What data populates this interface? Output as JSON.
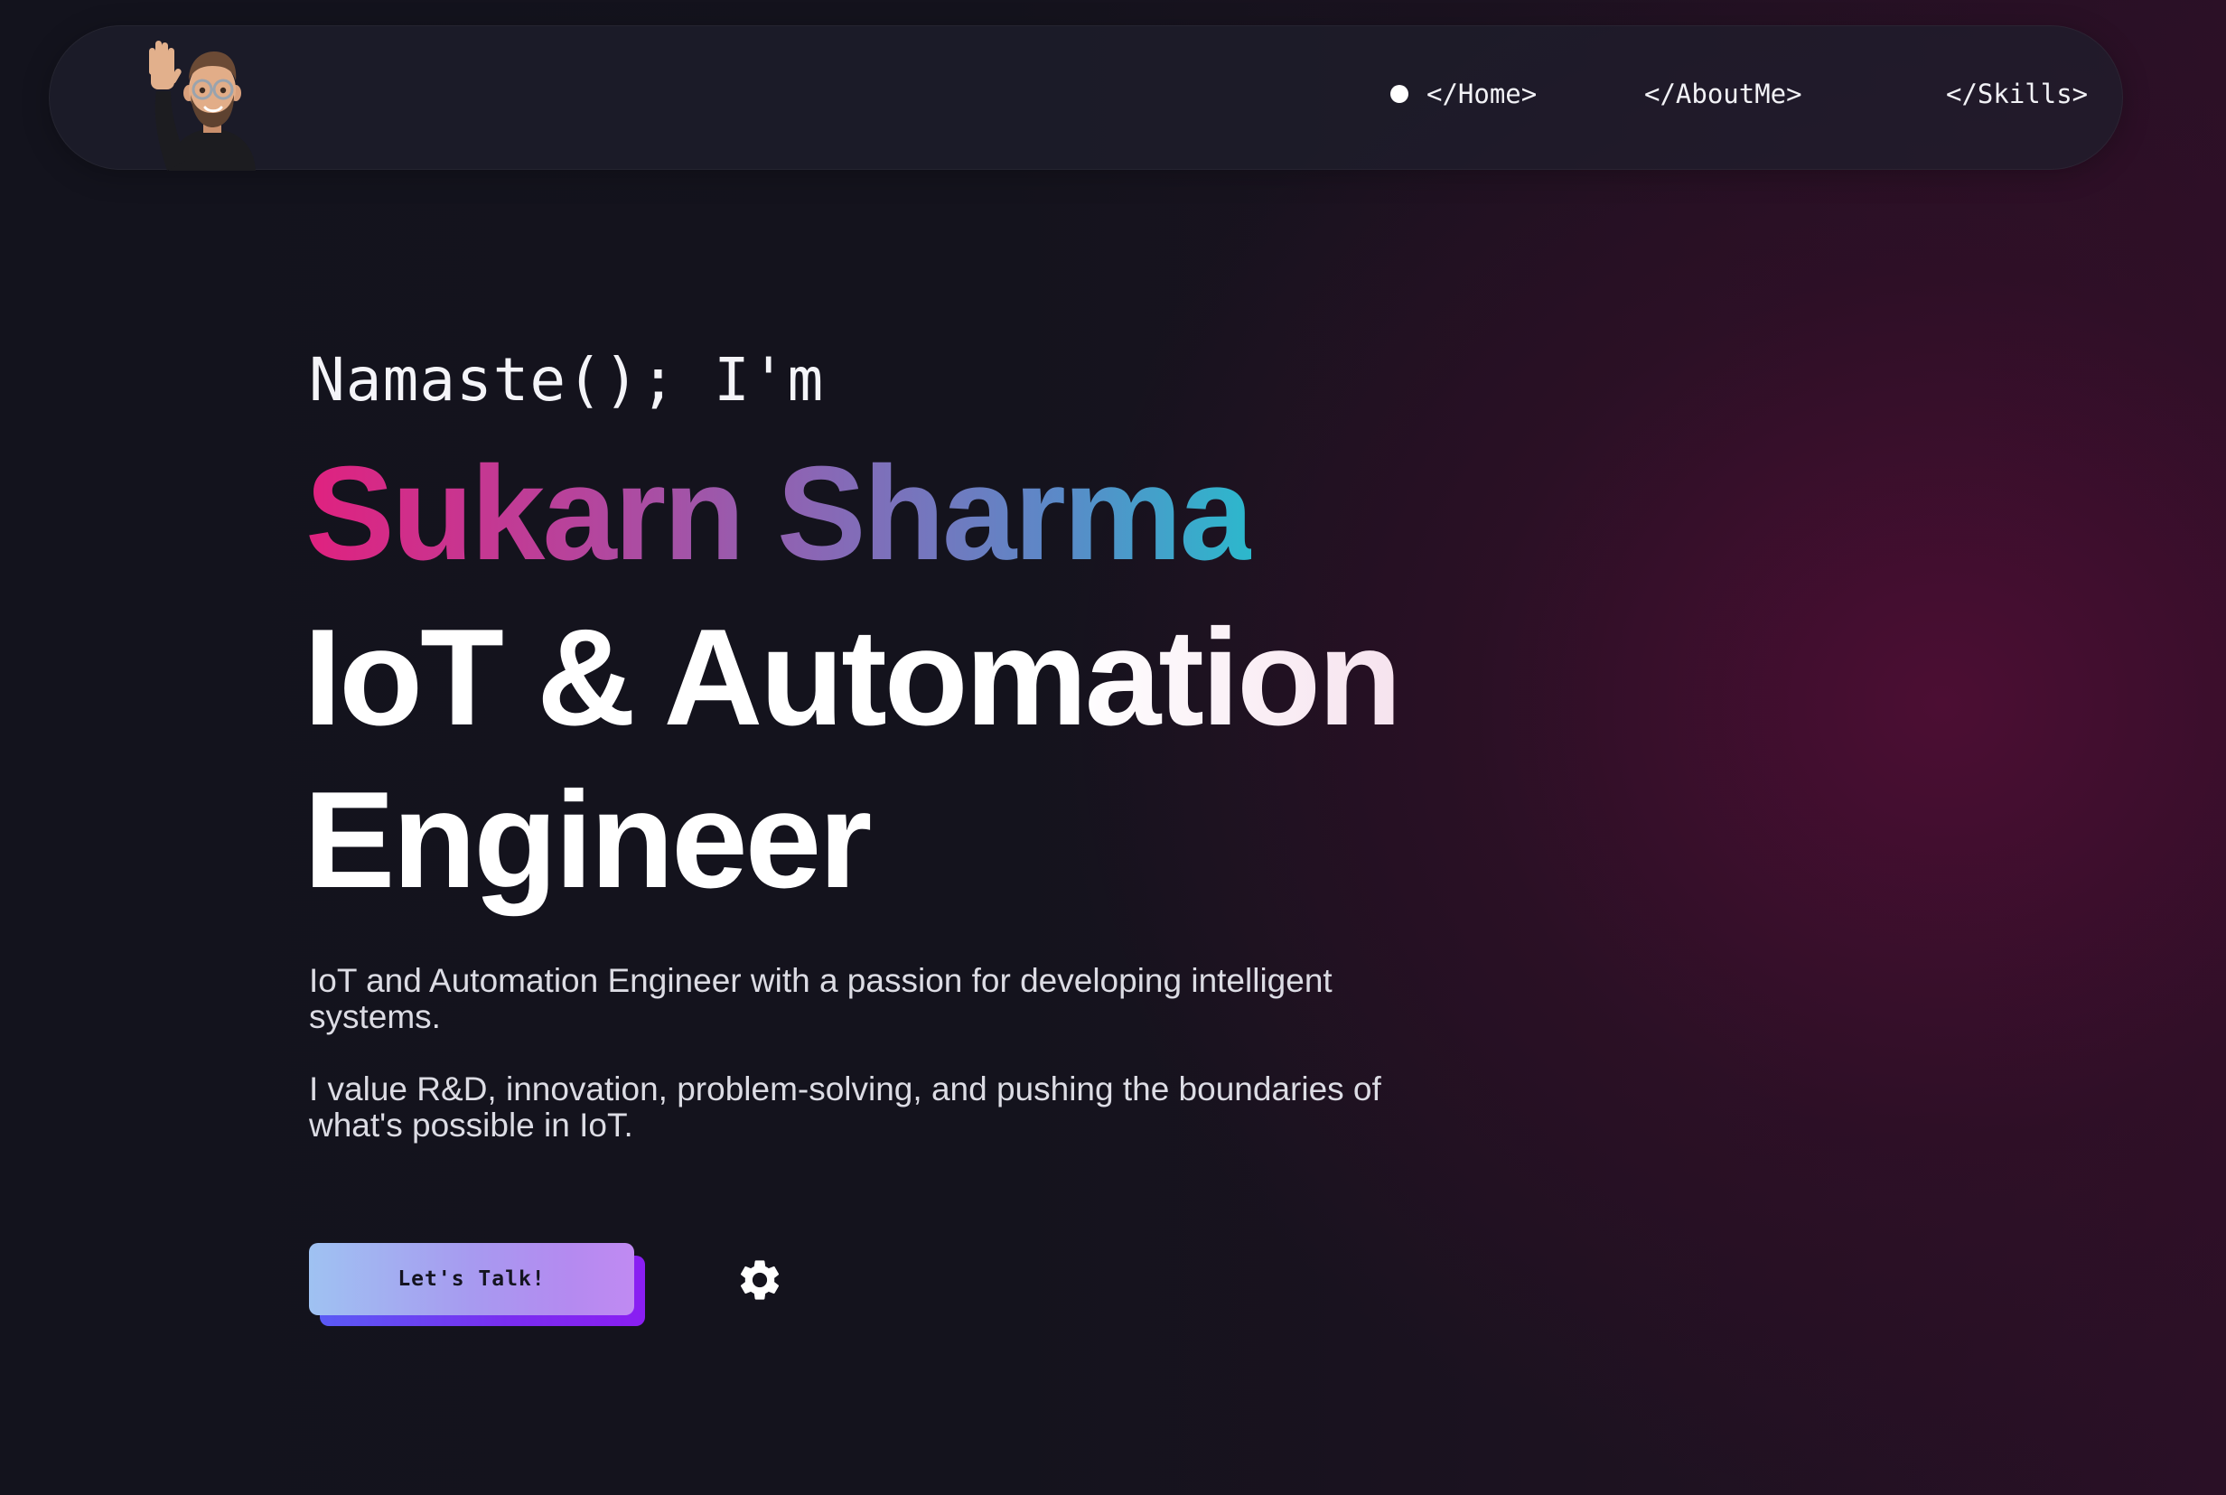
{
  "navbar": {
    "avatar_icon": "waving-memoji-avatar-icon",
    "items": [
      {
        "label": "</Home>",
        "active": true
      },
      {
        "label": "</AboutMe>",
        "active": false
      },
      {
        "label": "</Skills>",
        "active": false
      }
    ]
  },
  "hero": {
    "greeting": "Namaste(); I'm",
    "name": "Sukarn Sharma",
    "title_line1": "IoT & Automation",
    "title_line2": "Engineer",
    "description_1": "IoT and Automation Engineer with a passion for developing intelligent systems.",
    "description_2": "I value R&D, innovation, problem-solving, and pushing the boundaries of what's possible in IoT."
  },
  "cta": {
    "label": "Let's Talk!"
  },
  "settings": {
    "icon": "gear-icon"
  },
  "colors": {
    "name_gradient_start": "#e0217f",
    "name_gradient_end": "#2cb8cc",
    "cta_gradient_start": "#9fc2f2",
    "cta_gradient_end": "#c08af2",
    "cta_shadow": "#7a2cf0",
    "background": "#13131d"
  }
}
